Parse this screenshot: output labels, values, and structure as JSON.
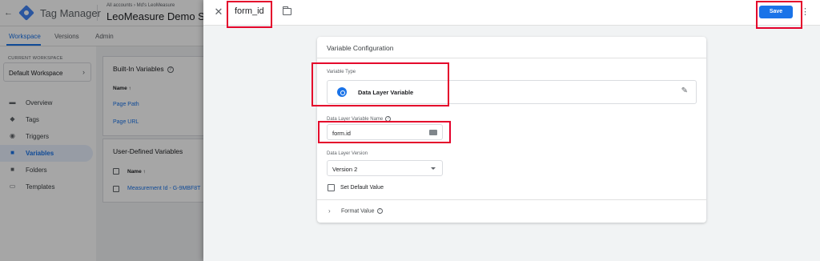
{
  "app": {
    "title": "Tag Manager",
    "breadcrumb": "All accounts › Md's LeoMeasure",
    "container_name": "LeoMeasure Demo Site",
    "tabs": [
      {
        "label": "Workspace",
        "active": true
      },
      {
        "label": "Versions",
        "active": false
      },
      {
        "label": "Admin",
        "active": false
      }
    ]
  },
  "sidebar": {
    "current_workspace_label": "CURRENT WORKSPACE",
    "workspace_name": "Default Workspace",
    "items": [
      {
        "label": "Overview",
        "icon": "overview-icon",
        "active": false
      },
      {
        "label": "Tags",
        "icon": "tag-icon",
        "active": false
      },
      {
        "label": "Triggers",
        "icon": "trigger-icon",
        "active": false
      },
      {
        "label": "Variables",
        "icon": "variables-icon",
        "active": true
      },
      {
        "label": "Folders",
        "icon": "folder-icon",
        "active": false
      },
      {
        "label": "Templates",
        "icon": "templates-icon",
        "active": false
      }
    ]
  },
  "builtin_variables": {
    "title": "Built-In Variables",
    "col_name": "Name ↑",
    "rows": [
      "Page Path",
      "Page URL"
    ]
  },
  "user_defined_variables": {
    "title": "User-Defined Variables",
    "col_name": "Name ↑",
    "rows": [
      "Measurement Id - G-9MBF8T"
    ]
  },
  "panel": {
    "name": "form_id",
    "save_label": "Save",
    "config": {
      "title": "Variable Configuration",
      "variable_type_label": "Variable Type",
      "variable_type_name": "Data Layer Variable",
      "dl_name_label": "Data Layer Variable Name",
      "dl_name_value": "form.id",
      "dl_version_label": "Data Layer Version",
      "dl_version_value": "Version 2",
      "set_default_label": "Set Default Value",
      "set_default_checked": false,
      "format_value_label": "Format Value"
    }
  },
  "colors": {
    "accent": "#1a73e8",
    "annotation_red": "#e4002b"
  }
}
